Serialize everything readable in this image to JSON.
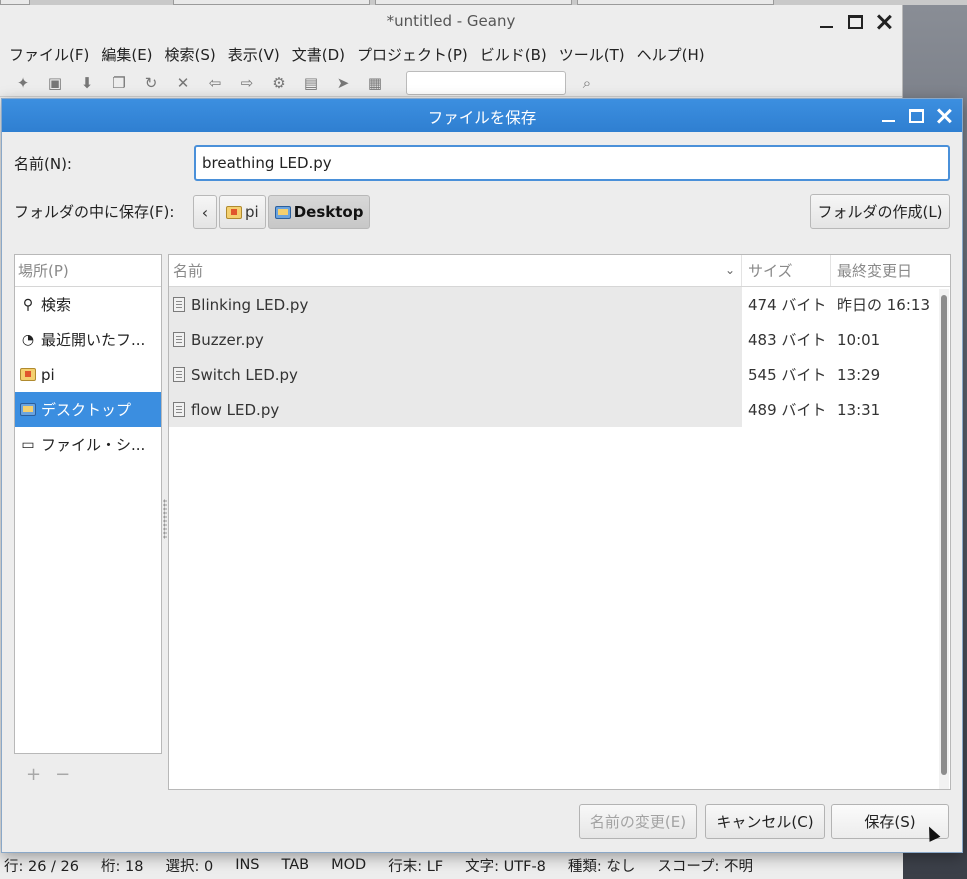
{
  "geany": {
    "title": "*untitled - Geany",
    "menu": [
      "ファイル(F)",
      "編集(E)",
      "検索(S)",
      "表示(V)",
      "文書(D)",
      "プロジェクト(P)",
      "ビルド(B)",
      "ツール(T)",
      "ヘルプ(H)"
    ],
    "status": [
      "行: 26 / 26",
      "桁: 18",
      "選択: 0",
      "INS",
      "TAB",
      "MOD",
      "行末: LF",
      "文字: UTF-8",
      "種類: なし",
      "スコープ: 不明"
    ]
  },
  "dialog": {
    "title": "ファイルを保存",
    "name_label": "名前(N):",
    "name_value": "breathing LED.py",
    "folder_label": "フォルダの中に保存(F):",
    "path": [
      "pi",
      "Desktop"
    ],
    "mkdir_label": "フォルダの作成(L)",
    "places": {
      "header": "場所(P)",
      "items": [
        {
          "label": "検索",
          "icon": "search-icon"
        },
        {
          "label": "最近開いたフ...",
          "icon": "recent-icon"
        },
        {
          "label": "pi",
          "icon": "home-folder-icon"
        },
        {
          "label": "デスクトップ",
          "icon": "desktop-folder-icon"
        },
        {
          "label": "ファイル・シ...",
          "icon": "drive-icon"
        }
      ],
      "add_symbol": "+",
      "remove_symbol": "−"
    },
    "files": {
      "headers": {
        "name": "名前",
        "size": "サイズ",
        "date": "最終変更日"
      },
      "rows": [
        {
          "name": "Blinking LED.py",
          "size": "474 バイト",
          "date": "昨日の 16:13"
        },
        {
          "name": "Buzzer.py",
          "size": "483 バイト",
          "date": "10:01"
        },
        {
          "name": "Switch LED.py",
          "size": "545 バイト",
          "date": "13:29"
        },
        {
          "name": "flow LED.py",
          "size": "489 バイト",
          "date": "13:31"
        }
      ]
    },
    "buttons": {
      "rename": "名前の変更(E)",
      "cancel": "キャンセル(C)",
      "save": "保存(S)"
    }
  }
}
